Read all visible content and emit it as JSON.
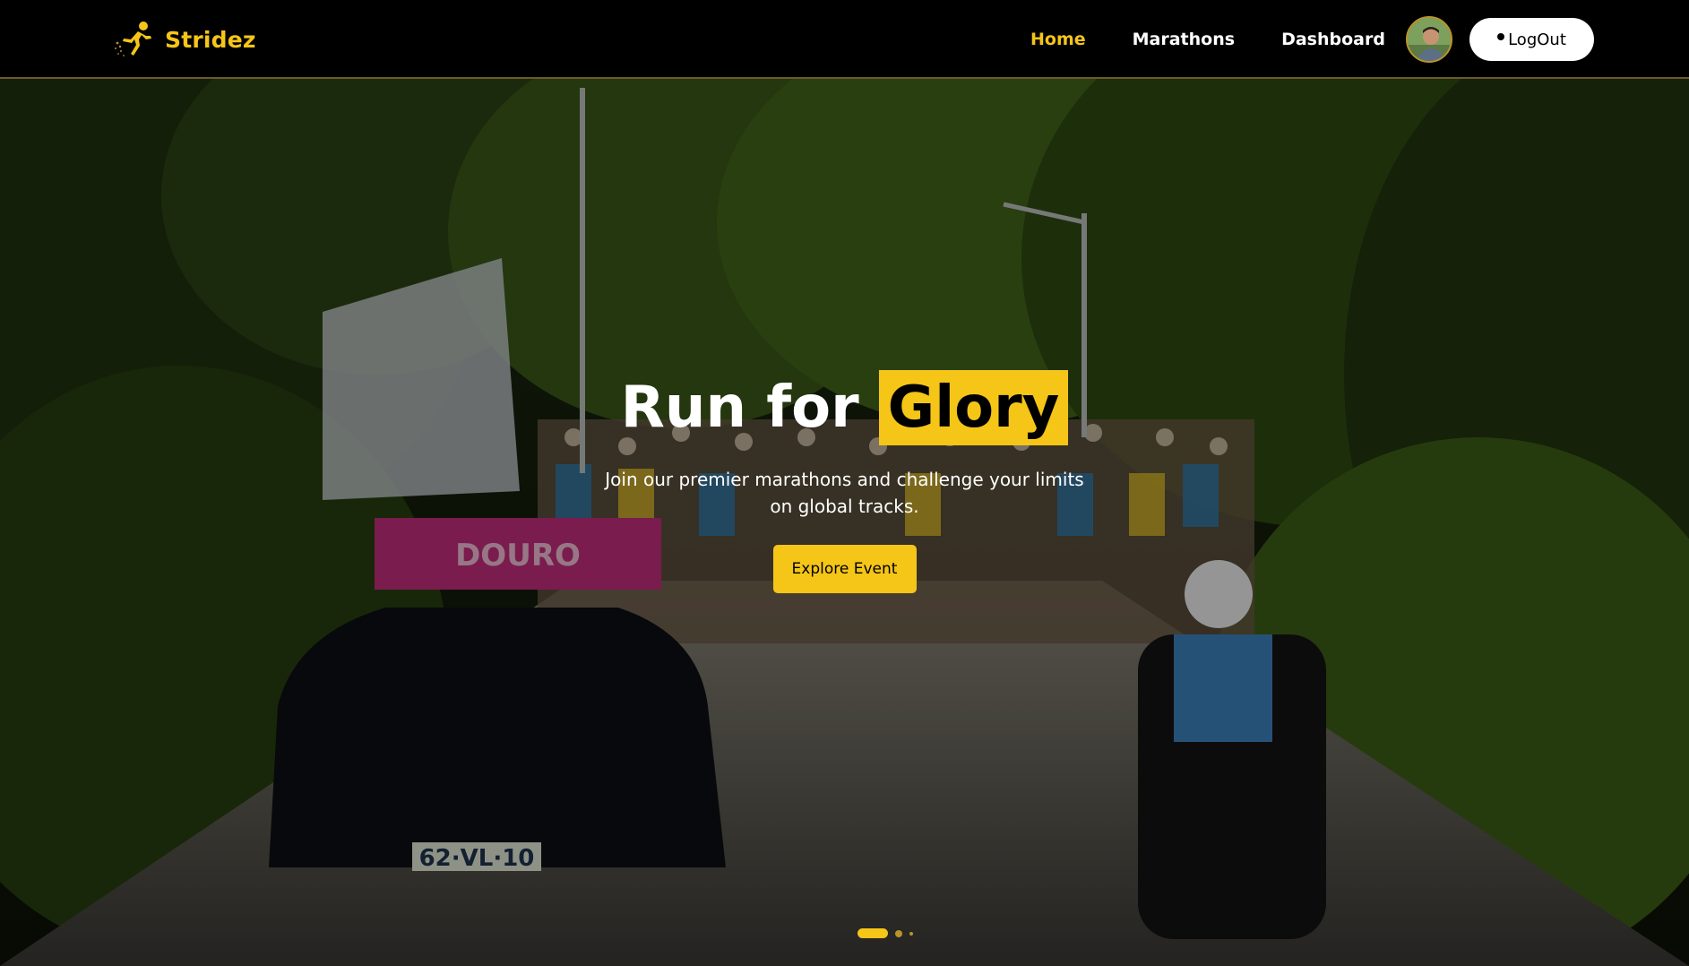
{
  "brand": {
    "name": "Stridez",
    "logo_icon": "runner-icon"
  },
  "nav": {
    "links": [
      {
        "label": "Home",
        "active": true
      },
      {
        "label": "Marathons",
        "active": false
      },
      {
        "label": "Dashboard",
        "active": false
      }
    ],
    "logout_label": "LogOut"
  },
  "hero": {
    "title_prefix": "Run for",
    "title_highlight": "Glory",
    "subtitle": "Join our premier marathons and challenge your limits on global tracks.",
    "cta_label": "Explore Event",
    "slides_total": 3,
    "active_slide": 1
  },
  "colors": {
    "accent": "#f5c518",
    "nav_bg": "#000000",
    "text": "#ffffff"
  }
}
